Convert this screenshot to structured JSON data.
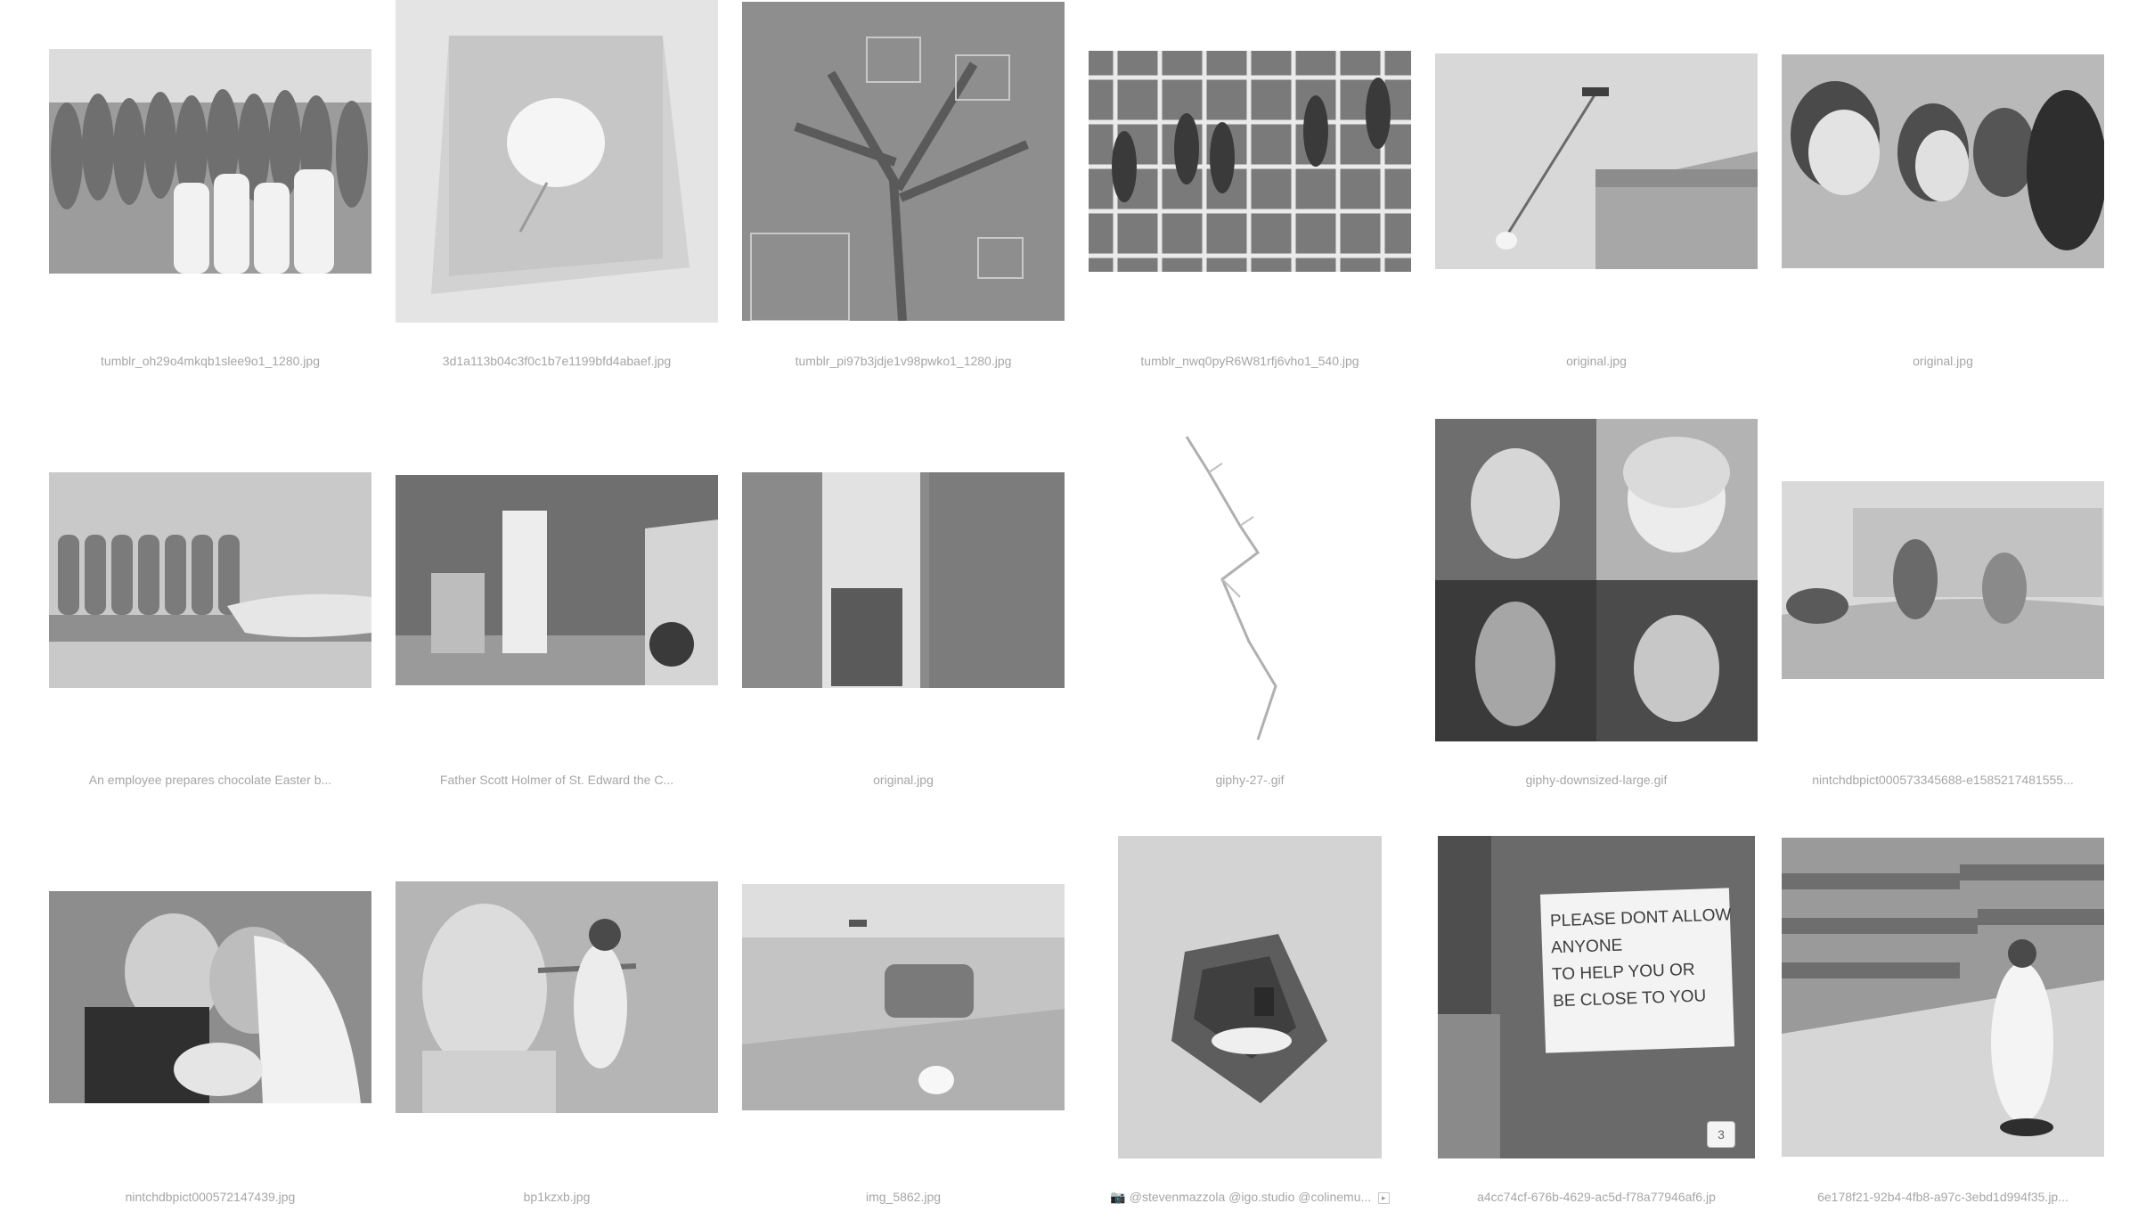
{
  "gallery": {
    "items": [
      {
        "caption": "tumblr_oh29o4mkqb1slee9o1_1280.jpg",
        "subject": "people in protective suits near crowd"
      },
      {
        "caption": "3d1a113b04c3f0c1b7e1199bfd4abaef.jpg",
        "subject": "rose inside glass cube"
      },
      {
        "caption": "tumblr_pi97b3jdje1v98pwko1_1280.jpg",
        "subject": "tree with square overlays"
      },
      {
        "caption": "tumblr_nwq0pyR6W81rfj6vho1_540.jpg",
        "subject": "people climbing grid"
      },
      {
        "caption": "original.jpg",
        "subject": "drone carrying bag near building"
      },
      {
        "caption": "original.jpg",
        "subject": "group wearing masks"
      },
      {
        "caption": "An employee prepares chocolate Easter b...",
        "subject": "chocolate bunnies with masks"
      },
      {
        "caption": "Father Scott Holmer of St. Edward the C...",
        "subject": "priest seated by car"
      },
      {
        "caption": "original.jpg",
        "subject": "person at window"
      },
      {
        "caption": "giphy-27-.gif",
        "subject": "cable sketch"
      },
      {
        "caption": "giphy-downsized-large.gif",
        "subject": "four famous portraits"
      },
      {
        "caption": "nintchdbpict000573345688-e1585217481555...",
        "subject": "person with gas mask in bed"
      },
      {
        "caption": "nintchdbpict000572147439.jpg",
        "subject": "wedding kiss with masks"
      },
      {
        "caption": "bp1kzxb.jpg",
        "subject": "statue and cleaner"
      },
      {
        "caption": "img_5862.jpg",
        "subject": "drone walking dog"
      },
      {
        "caption": "@stevenmazzola @igo.studio @colinemu...",
        "subject": "sd card in ring box",
        "caption_icon": "camera-icon",
        "more_label": "▸"
      },
      {
        "caption": "a4cc74cf-676b-4629-ac5d-f78a77946af6.jp",
        "subject": "sign on door",
        "sign_lines": [
          "PLEASE DONT ALLOW",
          "ANYONE",
          "TO HELP YOU OR",
          "BE CLOSE TO YOU"
        ],
        "badge": "3"
      },
      {
        "caption": "6e178f21-92b4-4fb8-a97c-3ebd1d994f35.jp...",
        "subject": "priest on hoverboard in church"
      }
    ]
  },
  "colors": {
    "background": "#ffffff",
    "caption": "#a6a6a6",
    "thumb_tone": "#cfcfcf"
  }
}
